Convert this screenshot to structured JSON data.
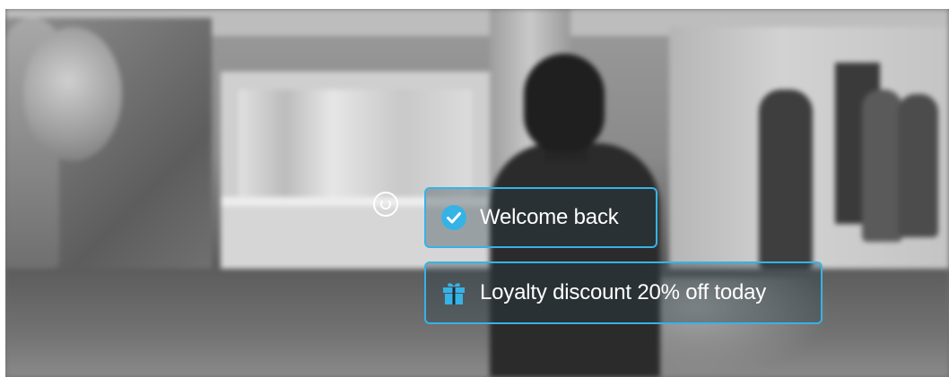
{
  "overlay": {
    "welcome_text": "Welcome back",
    "loyalty_text": "Loyalty discount 20% off today"
  },
  "icons": {
    "welcome_icon": "check-circle-icon",
    "loyalty_icon": "gift-icon",
    "scan_indicator": "loading-ring-icon"
  },
  "colors": {
    "accent": "#36b3e6",
    "text": "#ffffff"
  }
}
